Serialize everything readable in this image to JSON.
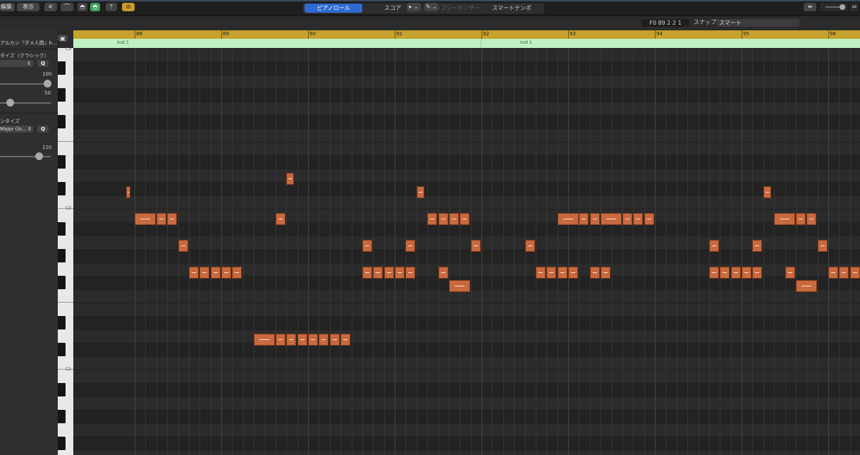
{
  "header": {
    "tabs": [
      {
        "label": "ピアノロール",
        "state": "active"
      },
      {
        "label": "スコア",
        "state": "normal"
      },
      {
        "label": "ステップシーケンサー",
        "state": "disabled"
      },
      {
        "label": "スマートテンポ",
        "state": "normal"
      }
    ]
  },
  "toolbar": {
    "edit_menu": "編集",
    "view_menu": "表示",
    "pointer_tool": "▸ ⌄",
    "pencil_tool": "✎ ⌄",
    "position": "F0   89 2 2 1",
    "snap_label": "スナップ:",
    "snap_value": "スマート",
    "colors": {
      "link_button": "#c99b2c",
      "midi_in_button": "#3aa55a",
      "active_tab": "#2e6ad1"
    }
  },
  "inspector": {
    "region_name": "アルカン『ダメ人間』b...",
    "quantize_title": "タイズ（クラシック）",
    "quantize_q": "Q",
    "strength_value": "100",
    "swing_value": "50",
    "scale_title": "ンタイズ",
    "scale_value": "Major (lo...",
    "scale_q": "Q",
    "velocity_value": "110",
    "levels": {
      "strength": 1.0,
      "swing": 0.5,
      "velocity": 0.85
    }
  },
  "keyboard": {
    "labels": [
      "C3",
      "C2",
      "C1"
    ]
  },
  "ruler": {
    "bars": [
      "88",
      "89",
      "90",
      "91",
      "92",
      "93",
      "94",
      "95",
      "96"
    ]
  },
  "regions": [
    {
      "label": "Inst 1"
    },
    {
      "label": "Inst 1"
    }
  ],
  "notes": [
    {
      "bar": 87.9,
      "dur": 0.06,
      "pitch": "A#1"
    },
    {
      "bar": 89.75,
      "dur": 0.1,
      "pitch": "B1"
    },
    {
      "bar": 91.25,
      "dur": 0.1,
      "pitch": "A#1"
    },
    {
      "bar": 95.25,
      "dur": 0.1,
      "pitch": "A#1"
    },
    {
      "bar": 88.0,
      "dur": 0.25,
      "pitch": "G#1"
    },
    {
      "bar": 88.25,
      "dur": 0.125,
      "pitch": "G#1"
    },
    {
      "bar": 88.375,
      "dur": 0.125,
      "pitch": "G#1"
    },
    {
      "bar": 89.625,
      "dur": 0.125,
      "pitch": "G#1"
    },
    {
      "bar": 91.375,
      "dur": 0.125,
      "pitch": "G#1"
    },
    {
      "bar": 91.5,
      "dur": 0.125,
      "pitch": "G#1"
    },
    {
      "bar": 91.625,
      "dur": 0.125,
      "pitch": "G#1"
    },
    {
      "bar": 91.75,
      "dur": 0.125,
      "pitch": "G#1"
    },
    {
      "bar": 92.875,
      "dur": 0.25,
      "pitch": "G#1"
    },
    {
      "bar": 93.125,
      "dur": 0.125,
      "pitch": "G#1"
    },
    {
      "bar": 93.25,
      "dur": 0.125,
      "pitch": "G#1"
    },
    {
      "bar": 93.375,
      "dur": 0.25,
      "pitch": "G#1"
    },
    {
      "bar": 93.625,
      "dur": 0.125,
      "pitch": "G#1"
    },
    {
      "bar": 93.75,
      "dur": 0.125,
      "pitch": "G#1"
    },
    {
      "bar": 93.875,
      "dur": 0.125,
      "pitch": "G#1"
    },
    {
      "bar": 95.375,
      "dur": 0.25,
      "pitch": "G#1"
    },
    {
      "bar": 95.625,
      "dur": 0.125,
      "pitch": "G#1"
    },
    {
      "bar": 95.75,
      "dur": 0.125,
      "pitch": "G#1"
    },
    {
      "bar": 88.5,
      "dur": 0.125,
      "pitch": "F#1"
    },
    {
      "bar": 90.625,
      "dur": 0.125,
      "pitch": "F#1"
    },
    {
      "bar": 91.125,
      "dur": 0.125,
      "pitch": "F#1"
    },
    {
      "bar": 91.875,
      "dur": 0.125,
      "pitch": "F#1"
    },
    {
      "bar": 92.5,
      "dur": 0.125,
      "pitch": "F#1"
    },
    {
      "bar": 94.625,
      "dur": 0.125,
      "pitch": "F#1"
    },
    {
      "bar": 95.125,
      "dur": 0.125,
      "pitch": "F#1"
    },
    {
      "bar": 95.875,
      "dur": 0.125,
      "pitch": "F#1"
    },
    {
      "bar": 88.625,
      "dur": 0.125,
      "pitch": "E1"
    },
    {
      "bar": 88.75,
      "dur": 0.125,
      "pitch": "E1"
    },
    {
      "bar": 88.875,
      "dur": 0.125,
      "pitch": "E1"
    },
    {
      "bar": 89.0,
      "dur": 0.125,
      "pitch": "E1"
    },
    {
      "bar": 89.125,
      "dur": 0.125,
      "pitch": "E1"
    },
    {
      "bar": 90.625,
      "dur": 0.125,
      "pitch": "E1"
    },
    {
      "bar": 90.75,
      "dur": 0.125,
      "pitch": "E1"
    },
    {
      "bar": 90.875,
      "dur": 0.125,
      "pitch": "E1"
    },
    {
      "bar": 91.0,
      "dur": 0.125,
      "pitch": "E1"
    },
    {
      "bar": 91.125,
      "dur": 0.125,
      "pitch": "E1"
    },
    {
      "bar": 91.5,
      "dur": 0.125,
      "pitch": "E1"
    },
    {
      "bar": 92.625,
      "dur": 0.125,
      "pitch": "E1"
    },
    {
      "bar": 92.75,
      "dur": 0.125,
      "pitch": "E1"
    },
    {
      "bar": 92.875,
      "dur": 0.125,
      "pitch": "E1"
    },
    {
      "bar": 93.0,
      "dur": 0.125,
      "pitch": "E1"
    },
    {
      "bar": 93.25,
      "dur": 0.125,
      "pitch": "E1"
    },
    {
      "bar": 93.375,
      "dur": 0.125,
      "pitch": "E1"
    },
    {
      "bar": 94.625,
      "dur": 0.125,
      "pitch": "E1"
    },
    {
      "bar": 94.75,
      "dur": 0.125,
      "pitch": "E1"
    },
    {
      "bar": 94.875,
      "dur": 0.125,
      "pitch": "E1"
    },
    {
      "bar": 95.0,
      "dur": 0.125,
      "pitch": "E1"
    },
    {
      "bar": 95.125,
      "dur": 0.125,
      "pitch": "E1"
    },
    {
      "bar": 95.5,
      "dur": 0.125,
      "pitch": "E1"
    },
    {
      "bar": 96.0,
      "dur": 0.125,
      "pitch": "E1"
    },
    {
      "bar": 96.125,
      "dur": 0.125,
      "pitch": "E1"
    },
    {
      "bar": 96.25,
      "dur": 0.125,
      "pitch": "E1"
    },
    {
      "bar": 91.625,
      "dur": 0.25,
      "pitch": "D#1"
    },
    {
      "bar": 95.625,
      "dur": 0.25,
      "pitch": "D#1"
    },
    {
      "bar": 89.375,
      "dur": 0.25,
      "pitch": "B0"
    },
    {
      "bar": 89.625,
      "dur": 0.125,
      "pitch": "B0"
    },
    {
      "bar": 89.75,
      "dur": 0.125,
      "pitch": "B0"
    },
    {
      "bar": 89.875,
      "dur": 0.125,
      "pitch": "B0"
    },
    {
      "bar": 90.0,
      "dur": 0.125,
      "pitch": "B0"
    },
    {
      "bar": 90.125,
      "dur": 0.125,
      "pitch": "B0"
    },
    {
      "bar": 90.25,
      "dur": 0.125,
      "pitch": "B0"
    },
    {
      "bar": 90.375,
      "dur": 0.125,
      "pitch": "B0"
    }
  ]
}
